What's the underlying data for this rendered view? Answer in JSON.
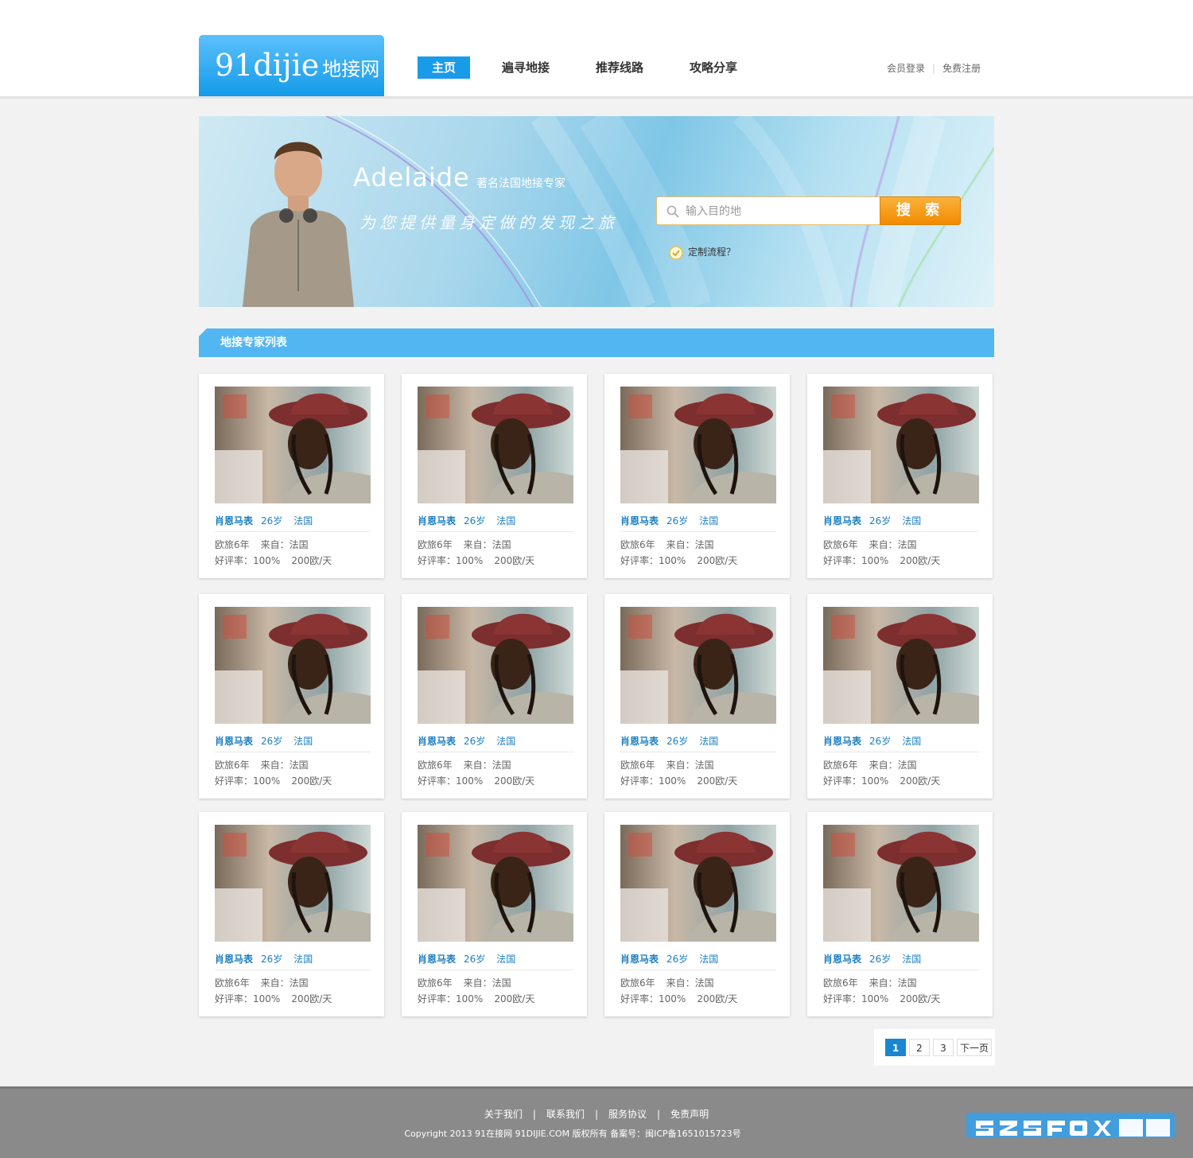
{
  "header": {
    "logo_en": "91dijie",
    "logo_cn": "地接网",
    "nav": [
      {
        "label": "主页"
      },
      {
        "label": "遍寻地接"
      },
      {
        "label": "推荐线路"
      },
      {
        "label": "攻略分享"
      }
    ],
    "login": "会员登录",
    "separator": "|",
    "register": "免费注册"
  },
  "banner": {
    "name": "Adelaide",
    "subtitle": "著名法国地接专家",
    "slogan": "为您提供量身定做的发现之旅",
    "search_placeholder": "输入目的地",
    "search_button": "搜 索",
    "custom_flow": "定制流程？"
  },
  "section": {
    "title": "地接专家列表"
  },
  "cards": [
    {
      "name": "肖恩马表",
      "age": "26岁",
      "country": "法国",
      "years": "欧旅6年",
      "from": "来自：法国",
      "rating": "好评率：100%",
      "price": "200欧/天"
    },
    {
      "name": "肖恩马表",
      "age": "26岁",
      "country": "法国",
      "years": "欧旅6年",
      "from": "来自：法国",
      "rating": "好评率：100%",
      "price": "200欧/天"
    },
    {
      "name": "肖恩马表",
      "age": "26岁",
      "country": "法国",
      "years": "欧旅6年",
      "from": "来自：法国",
      "rating": "好评率：100%",
      "price": "200欧/天"
    },
    {
      "name": "肖恩马表",
      "age": "26岁",
      "country": "法国",
      "years": "欧旅6年",
      "from": "来自：法国",
      "rating": "好评率：100%",
      "price": "200欧/天"
    },
    {
      "name": "肖恩马表",
      "age": "26岁",
      "country": "法国",
      "years": "欧旅6年",
      "from": "来自：法国",
      "rating": "好评率：100%",
      "price": "200欧/天"
    },
    {
      "name": "肖恩马表",
      "age": "26岁",
      "country": "法国",
      "years": "欧旅6年",
      "from": "来自：法国",
      "rating": "好评率：100%",
      "price": "200欧/天"
    },
    {
      "name": "肖恩马表",
      "age": "26岁",
      "country": "法国",
      "years": "欧旅6年",
      "from": "来自：法国",
      "rating": "好评率：100%",
      "price": "200欧/天"
    },
    {
      "name": "肖恩马表",
      "age": "26岁",
      "country": "法国",
      "years": "欧旅6年",
      "from": "来自：法国",
      "rating": "好评率：100%",
      "price": "200欧/天"
    },
    {
      "name": "肖恩马表",
      "age": "26岁",
      "country": "法国",
      "years": "欧旅6年",
      "from": "来自：法国",
      "rating": "好评率：100%",
      "price": "200欧/天"
    },
    {
      "name": "肖恩马表",
      "age": "26岁",
      "country": "法国",
      "years": "欧旅6年",
      "from": "来自：法国",
      "rating": "好评率：100%",
      "price": "200欧/天"
    },
    {
      "name": "肖恩马表",
      "age": "26岁",
      "country": "法国",
      "years": "欧旅6年",
      "from": "来自：法国",
      "rating": "好评率：100%",
      "price": "200欧/天"
    },
    {
      "name": "肖恩马表",
      "age": "26岁",
      "country": "法国",
      "years": "欧旅6年",
      "from": "来自：法国",
      "rating": "好评率：100%",
      "price": "200欧/天"
    }
  ],
  "pagination": {
    "pages": [
      "1",
      "2",
      "3"
    ],
    "current": "1",
    "next": "下一页"
  },
  "footer": {
    "links": [
      "关于我们",
      "联系我们",
      "服务协议",
      "免责声明"
    ],
    "separator": "|",
    "copyright": "Copyright 2013 91在接网 91DIJIE.COM 版权所有    备案号：闽ICP备1651015723号"
  },
  "colors": {
    "accent": "#1a9be8",
    "section_bar": "#52b6f2",
    "search_button": "#f28a00",
    "card_link": "#1b7ec2",
    "footer_bg": "#8a8a8a"
  }
}
